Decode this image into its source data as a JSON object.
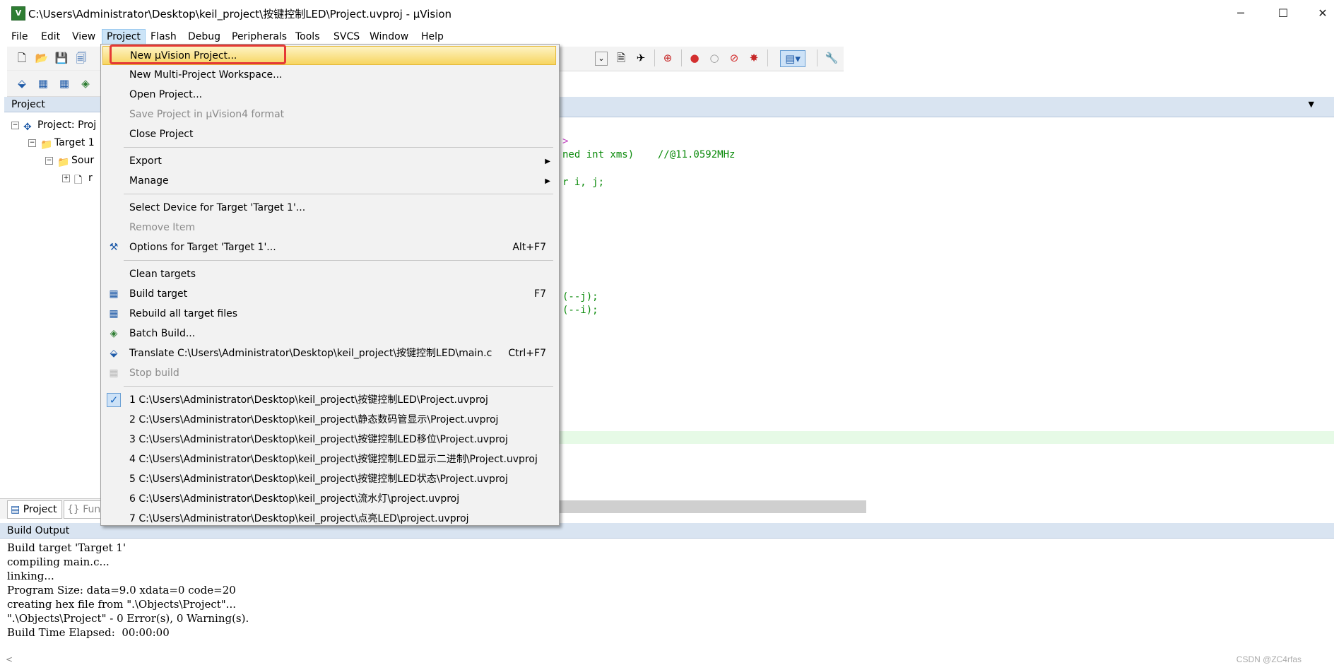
{
  "window": {
    "title": "C:\\Users\\Administrator\\Desktop\\keil_project\\按键控制LED\\Project.uvproj - µVision",
    "app_icon_glyph": "V",
    "minimize_glyph": "─",
    "maximize_glyph": "☐",
    "close_glyph": "✕"
  },
  "menubar": [
    "File",
    "Edit",
    "View",
    "Project",
    "Flash",
    "Debug",
    "Peripherals",
    "Tools",
    "SVCS",
    "Window",
    "Help"
  ],
  "project_panel": {
    "header": "Project",
    "tree": [
      "Project: Proj",
      "Target 1",
      "Sour",
      "r"
    ]
  },
  "editor": {
    "lines": [
      ">",
      "ned int xms)    //@11.0592MHz",
      "r i, j;",
      "(--j);",
      "(--i);"
    ]
  },
  "bottom_tabs": [
    "Project",
    "{} Func"
  ],
  "build_output": {
    "header": "Build Output",
    "lines": [
      "Build target 'Target 1'",
      "compiling main.c...",
      "linking...",
      "Program Size: data=9.0 xdata=0 code=20",
      "creating hex file from \".\\Objects\\Project\"...",
      "\".\\Objects\\Project\" - 0 Error(s), 0 Warning(s).",
      "Build Time Elapsed:  00:00:00"
    ]
  },
  "project_menu": {
    "items": [
      {
        "label": "New µVision Project...",
        "shortcut": "",
        "disabled": false,
        "highlight": true
      },
      {
        "label": "New Multi-Project Workspace...",
        "shortcut": "",
        "disabled": false
      },
      {
        "label": "Open Project...",
        "shortcut": "",
        "disabled": false
      },
      {
        "label": "Save Project in µVision4 format",
        "shortcut": "",
        "disabled": true
      },
      {
        "label": "Close Project",
        "shortcut": "",
        "disabled": false
      },
      {
        "label": "Export",
        "shortcut": "",
        "submenu": true
      },
      {
        "label": "Manage",
        "shortcut": "",
        "submenu": true
      },
      {
        "label": "Select Device for Target 'Target 1'...",
        "shortcut": ""
      },
      {
        "label": "Remove Item",
        "shortcut": "",
        "disabled": true
      },
      {
        "label": "Options for Target 'Target 1'...",
        "shortcut": "Alt+F7",
        "icon": "options-wand-icon"
      },
      {
        "label": "Clean targets",
        "shortcut": ""
      },
      {
        "label": "Build target",
        "shortcut": "F7",
        "icon": "build-icon"
      },
      {
        "label": "Rebuild all target files",
        "shortcut": "",
        "icon": "rebuild-icon"
      },
      {
        "label": "Batch Build...",
        "shortcut": "",
        "icon": "batch-build-icon"
      },
      {
        "label": "Translate C:\\Users\\Administrator\\Desktop\\keil_project\\按键控制LED\\main.c",
        "shortcut": "Ctrl+F7",
        "icon": "translate-icon"
      },
      {
        "label": "Stop build",
        "shortcut": "",
        "disabled": true,
        "icon": "stop-build-icon"
      },
      {
        "label": "1 C:\\Users\\Administrator\\Desktop\\keil_project\\按键控制LED\\Project.uvproj",
        "checked": true
      },
      {
        "label": "2 C:\\Users\\Administrator\\Desktop\\keil_project\\静态数码管显示\\Project.uvproj"
      },
      {
        "label": "3 C:\\Users\\Administrator\\Desktop\\keil_project\\按键控制LED移位\\Project.uvproj"
      },
      {
        "label": "4 C:\\Users\\Administrator\\Desktop\\keil_project\\按键控制LED显示二进制\\Project.uvproj"
      },
      {
        "label": "5 C:\\Users\\Administrator\\Desktop\\keil_project\\按键控制LED状态\\Project.uvproj"
      },
      {
        "label": "6 C:\\Users\\Administrator\\Desktop\\keil_project\\流水灯\\project.uvproj"
      },
      {
        "label": "7 C:\\Users\\Administrator\\Desktop\\keil_project\\点亮LED\\project.uvproj"
      }
    ]
  },
  "watermark": "CSDN @ZC4rfas",
  "colors": {
    "highlight": "#f7d560",
    "callout": "#e53935",
    "panel_header": "#d9e4f1"
  }
}
